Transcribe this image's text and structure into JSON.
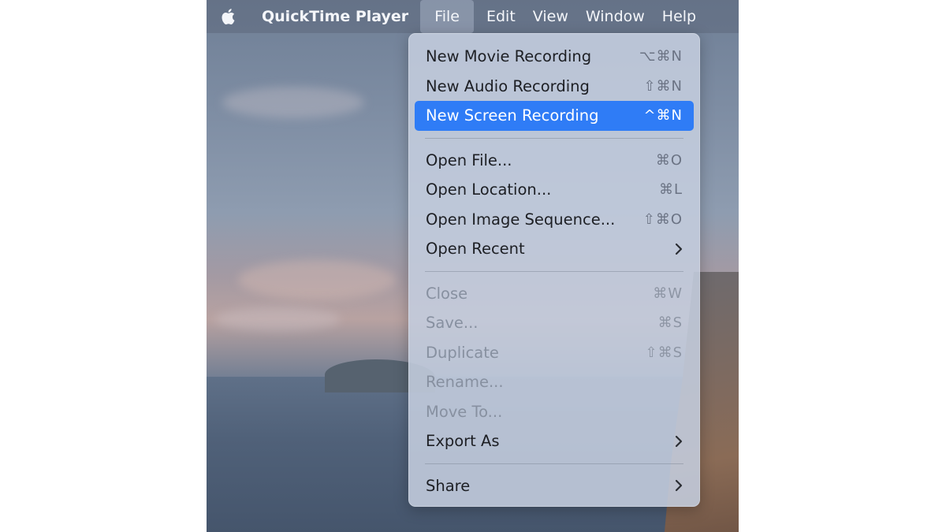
{
  "menubar": {
    "app_name": "QuickTime Player",
    "items": [
      "File",
      "Edit",
      "View",
      "Window",
      "Help"
    ],
    "active": "File"
  },
  "file_menu": {
    "groups": [
      [
        {
          "label": "New Movie Recording",
          "shortcut": "⌥⌘N",
          "state": "enabled"
        },
        {
          "label": "New Audio Recording",
          "shortcut": "⇧⌘N",
          "state": "enabled"
        },
        {
          "label": "New Screen Recording",
          "shortcut": "^⌘N",
          "state": "selected"
        }
      ],
      [
        {
          "label": "Open File...",
          "shortcut": "⌘O",
          "state": "enabled"
        },
        {
          "label": "Open Location...",
          "shortcut": "⌘L",
          "state": "enabled"
        },
        {
          "label": "Open Image Sequence...",
          "shortcut": "⇧⌘O",
          "state": "enabled"
        },
        {
          "label": "Open Recent",
          "submenu": true,
          "state": "enabled"
        }
      ],
      [
        {
          "label": "Close",
          "shortcut": "⌘W",
          "state": "disabled"
        },
        {
          "label": "Save...",
          "shortcut": "⌘S",
          "state": "disabled"
        },
        {
          "label": "Duplicate",
          "shortcut": "⇧⌘S",
          "state": "disabled"
        },
        {
          "label": "Rename...",
          "state": "disabled"
        },
        {
          "label": "Move To...",
          "state": "disabled"
        },
        {
          "label": "Export As",
          "submenu": true,
          "state": "enabled"
        }
      ],
      [
        {
          "label": "Share",
          "submenu": true,
          "state": "enabled"
        }
      ]
    ]
  },
  "colors": {
    "selection": "#2f7cf6",
    "menu_background": "#c4cdde",
    "disabled_text": "#8790a0"
  },
  "icons": {
    "apple": "apple-logo-icon",
    "submenu": "chevron-right-icon"
  }
}
